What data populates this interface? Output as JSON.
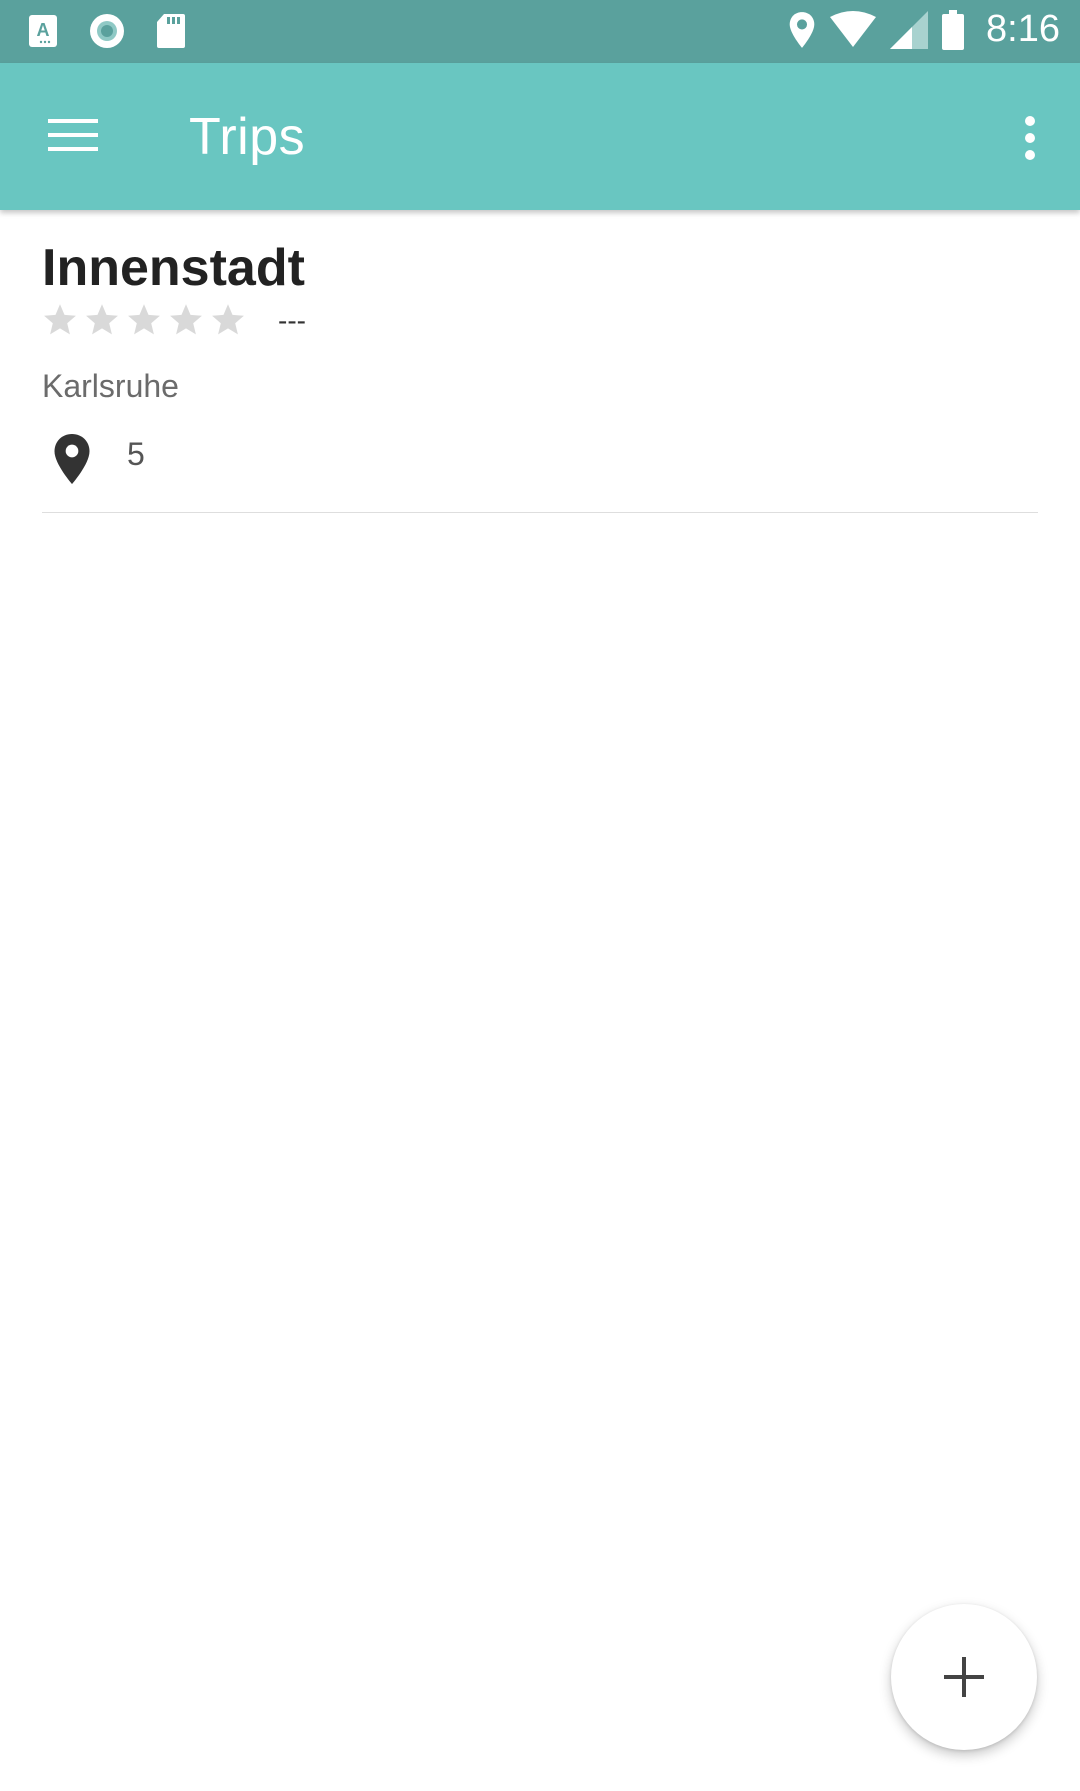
{
  "status_bar": {
    "time": "8:16",
    "icons_left": [
      "translate-icon",
      "record-icon",
      "sd-card-icon"
    ],
    "icons_right": [
      "location-icon",
      "wifi-icon",
      "signal-icon",
      "battery-icon"
    ]
  },
  "app_bar": {
    "title": "Trips",
    "menu_icon": "hamburger-icon",
    "overflow_icon": "more-vert-icon",
    "color": "#69c6c1"
  },
  "trips": [
    {
      "title": "Innenstadt",
      "rating_stars": 0,
      "rating_max": 5,
      "rating_text": "---",
      "city": "Karlsruhe",
      "places_count": "5"
    }
  ],
  "fab": {
    "icon": "plus-icon"
  },
  "colors": {
    "status_bar": "#5aa19d",
    "star_empty": "#d9d9d9",
    "text_primary": "#222222",
    "text_secondary": "#6b6b6b"
  }
}
